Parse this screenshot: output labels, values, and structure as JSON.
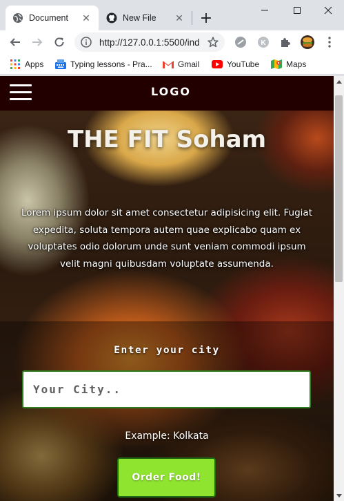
{
  "browser": {
    "tabs": [
      {
        "title": "Document",
        "icon": "globe-icon",
        "active": true
      },
      {
        "title": "New File",
        "icon": "github-icon",
        "active": false
      }
    ],
    "url": "http://127.0.0.1:5500/ind",
    "bookmarks": [
      {
        "label": "Apps",
        "icon": "apps-grid-icon"
      },
      {
        "label": "Typing lessons - Pra...",
        "icon": "typing-icon"
      },
      {
        "label": "Gmail",
        "icon": "gmail-icon"
      },
      {
        "label": "YouTube",
        "icon": "youtube-icon"
      },
      {
        "label": "Maps",
        "icon": "maps-icon"
      }
    ]
  },
  "site": {
    "logo": "LOGO",
    "hero_title": "THE FIT Soham",
    "hero_text": "Lorem ipsum dolor sit amet consectetur adipisicing elit. Fugiat expedita, soluta tempora autem quae explicabo quam ex voluptates odio dolorum unde sunt veniam commodi ipsum velit magni quibusdam voluptate assumenda.",
    "city_label": "Enter your city",
    "city_placeholder": "Your City..",
    "example": "Example: Kolkata",
    "order_button": "Order Food!"
  },
  "colors": {
    "nav_bg": "#220000",
    "button_bg": "#8ee42f",
    "input_border": "#2e7d1e"
  }
}
